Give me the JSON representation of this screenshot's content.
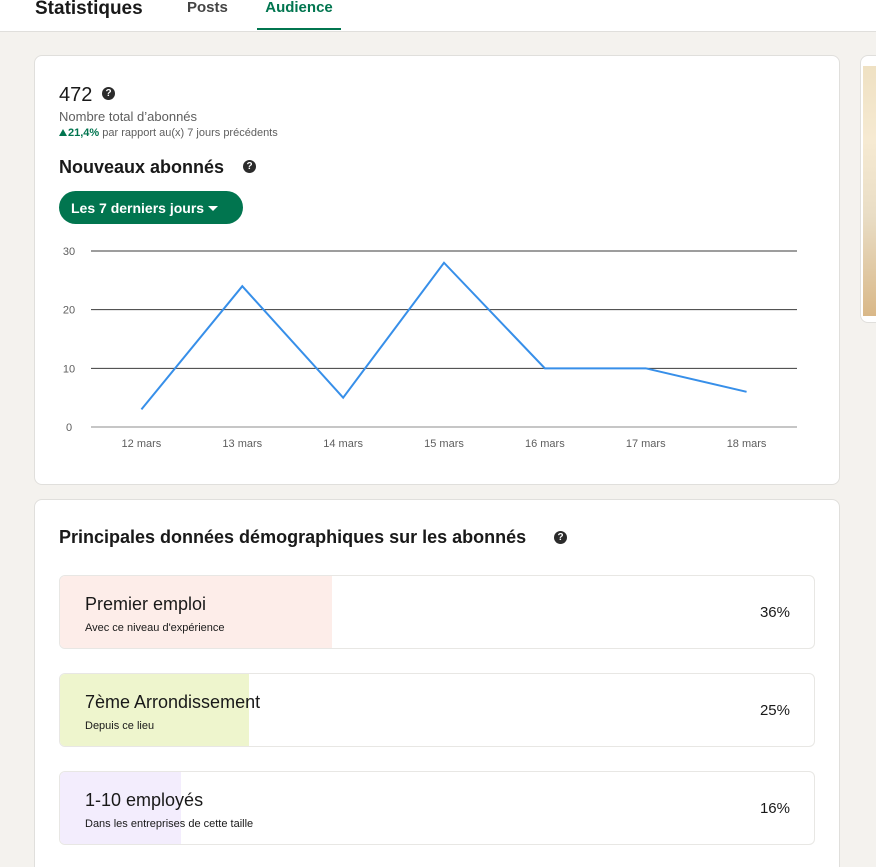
{
  "header": {
    "title": "Statistiques",
    "tabs": [
      {
        "label": "Posts"
      },
      {
        "label": "Audience"
      }
    ]
  },
  "summary": {
    "total": "472",
    "total_label": "Nombre total d’abonnés",
    "trend_value": "21,4%",
    "trend_text": " par rapport au(x) 7 jours précédents",
    "section_title": "Nouveaux abonnés",
    "range_label": "Les 7 derniers jours",
    "help_glyph": "?"
  },
  "chart_data": {
    "type": "line",
    "categories": [
      "12 mars",
      "13 mars",
      "14 mars",
      "15 mars",
      "16 mars",
      "17 mars",
      "18 mars"
    ],
    "values": [
      3,
      24,
      5,
      28,
      10,
      10,
      6
    ],
    "ylim": [
      0,
      30
    ],
    "yticks": [
      0,
      10,
      20,
      30
    ],
    "grid": true,
    "line_color": "#378fe9"
  },
  "demographics": {
    "title": "Principales données démographiques sur les abonnés",
    "items": [
      {
        "label": "Premier emploi",
        "sub": "Avec ce niveau d'expérience",
        "pct": "36%",
        "fraction": 0.36,
        "color": "#fdede9"
      },
      {
        "label": "7ème Arrondissement",
        "sub": "Depuis ce lieu",
        "pct": "25%",
        "fraction": 0.25,
        "color": "#eef5cd"
      },
      {
        "label": "1-10 employés",
        "sub": "Dans les entreprises de cette taille",
        "pct": "16%",
        "fraction": 0.16,
        "color": "#f3edfd"
      }
    ]
  }
}
